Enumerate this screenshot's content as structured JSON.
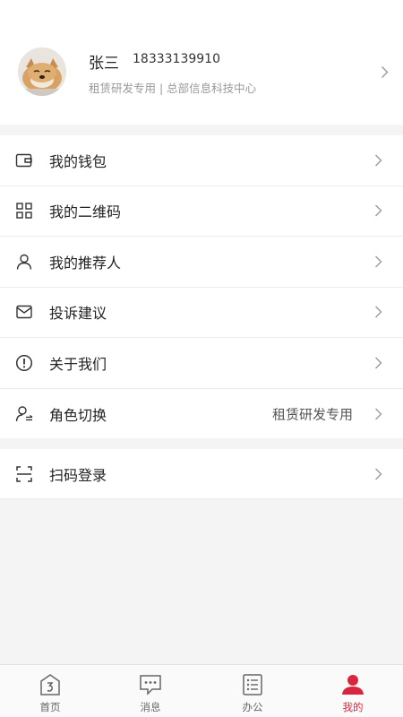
{
  "profile": {
    "name": "张三",
    "phone": "18333139910",
    "department": "租赁研发专用 | 总部信息科技中心"
  },
  "menu": [
    {
      "label": "我的钱包",
      "icon": "wallet-icon"
    },
    {
      "label": "我的二维码",
      "icon": "qr-grid-icon"
    },
    {
      "label": "我的推荐人",
      "icon": "person-icon"
    },
    {
      "label": "投诉建议",
      "icon": "mail-icon"
    },
    {
      "label": "关于我们",
      "icon": "info-icon"
    },
    {
      "label": "角色切换",
      "icon": "role-switch-icon",
      "value": "租赁研发专用"
    }
  ],
  "menu2": [
    {
      "label": "扫码登录",
      "icon": "scan-icon"
    }
  ],
  "tabs": [
    {
      "label": "首页",
      "icon": "home-icon"
    },
    {
      "label": "消息",
      "icon": "message-icon"
    },
    {
      "label": "办公",
      "icon": "office-list-icon"
    },
    {
      "label": "我的",
      "icon": "profile-icon",
      "active": true
    }
  ],
  "colors": {
    "accent": "#d7263d",
    "background": "#f4f4f4",
    "text": "#222222",
    "muted": "#999999"
  }
}
